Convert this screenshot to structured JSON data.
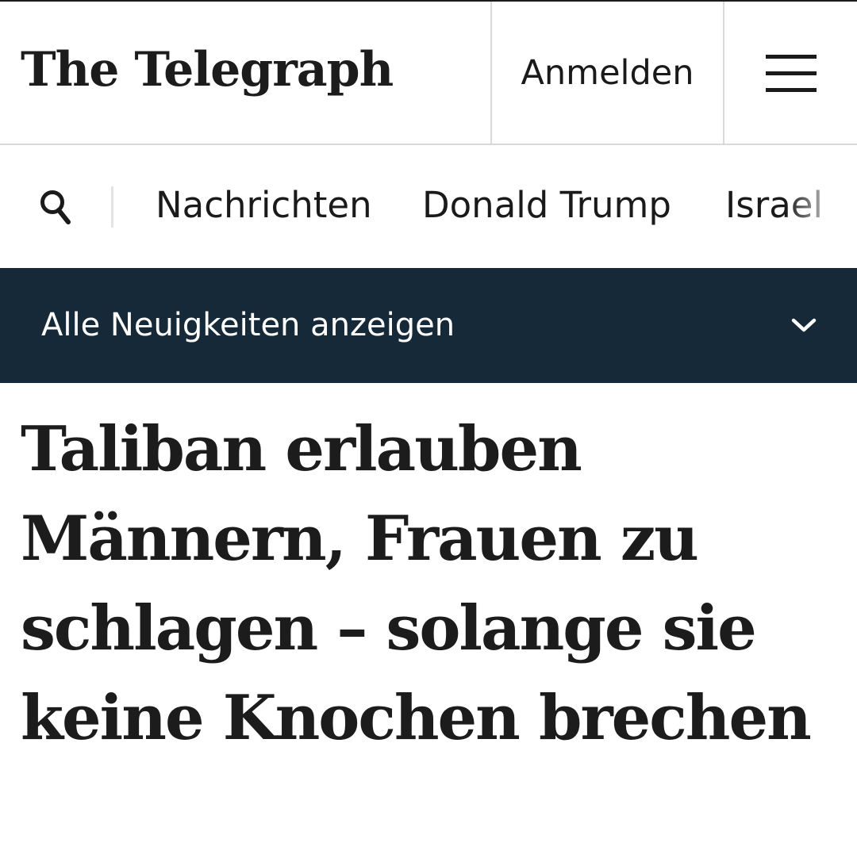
{
  "header": {
    "logo_text": "The Telegraph",
    "login_label": "Anmelden",
    "menu_icon": "hamburger-menu-icon"
  },
  "nav": {
    "search_icon": "search-icon",
    "items": [
      {
        "label": "Nachrichten"
      },
      {
        "label": "Donald Trump"
      },
      {
        "label": "Israel"
      }
    ]
  },
  "banner": {
    "label": "Alle Neuigkeiten anzeigen",
    "chevron_icon": "chevron-down-icon"
  },
  "article": {
    "headline": "Taliban erlauben Männern, Frauen zu schlagen – solange sie keine Knochen brechen"
  },
  "colors": {
    "banner_background": "#162938",
    "text": "#1a1a1a",
    "divider": "#d9d9d9",
    "banner_text": "#ffffff"
  }
}
